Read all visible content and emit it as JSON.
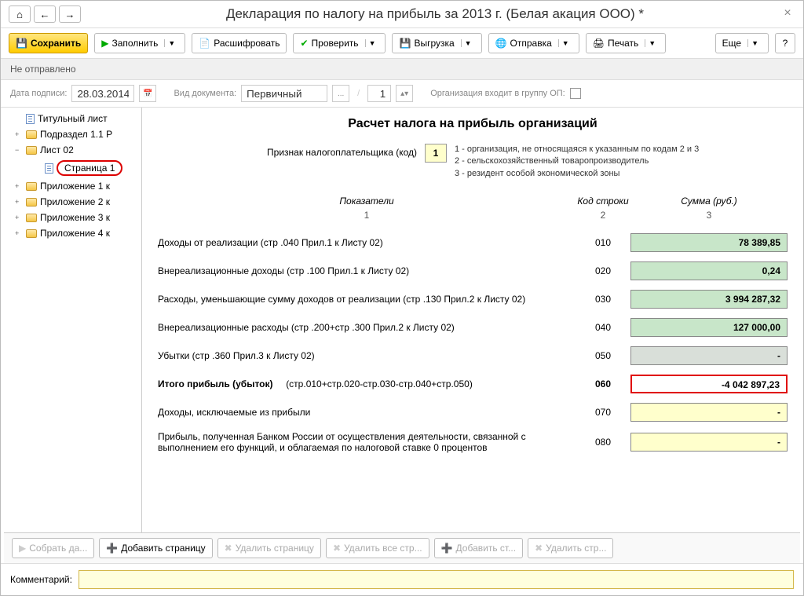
{
  "title": "Декларация по налогу на прибыль за 2013 г. (Белая акация ООО) *",
  "toolbar": {
    "save": "Сохранить",
    "fill": "Заполнить",
    "decode": "Расшифровать",
    "check": "Проверить",
    "export": "Выгрузка",
    "send": "Отправка",
    "print": "Печать",
    "more": "Еще"
  },
  "status": "Не отправлено",
  "params": {
    "date_label": "Дата подписи:",
    "date_value": "28.03.2014",
    "doc_type_label": "Вид документа:",
    "doc_type_value": "Первичный",
    "page_num": "1",
    "org_group_label": "Организация входит в группу ОП:"
  },
  "sidebar": {
    "items": [
      {
        "label": "Титульный лист",
        "type": "page",
        "indent": 1
      },
      {
        "label": "Подраздел 1.1 Р",
        "type": "folder",
        "indent": 1,
        "toggle": "+"
      },
      {
        "label": "Лист 02",
        "type": "folder",
        "indent": 1,
        "toggle": "−",
        "open": true
      },
      {
        "label": "Страница 1",
        "type": "page",
        "indent": 2,
        "selected": true
      },
      {
        "label": "Приложение 1 к",
        "type": "folder",
        "indent": 1,
        "toggle": "+"
      },
      {
        "label": "Приложение 2 к",
        "type": "folder",
        "indent": 1,
        "toggle": "+"
      },
      {
        "label": "Приложение 3 к",
        "type": "folder",
        "indent": 1,
        "toggle": "+"
      },
      {
        "label": "Приложение 4 к",
        "type": "folder",
        "indent": 1,
        "toggle": "+"
      }
    ]
  },
  "doc": {
    "heading": "Расчет налога на прибыль организаций",
    "taxpayer_label": "Признак налогоплательщика (код)",
    "taxpayer_code": "1",
    "taxpayer_notes": {
      "n1": "1 - организация, не относящаяся к указанным по кодам 2 и 3",
      "n2": "2 - сельскохозяйственный товаропроизводитель",
      "n3": "3 - резидент особой экономической зоны"
    },
    "headers": {
      "indicator": "Показатели",
      "code": "Код строки",
      "sum": "Сумма (руб.)",
      "c1": "1",
      "c2": "2",
      "c3": "3"
    },
    "rows": [
      {
        "label": "Доходы от реализации (стр .040 Прил.1 к Листу 02)",
        "code": "010",
        "value": "78 389,85",
        "style": "green"
      },
      {
        "label": "Внереализационные доходы (стр .100 Прил.1 к Листу 02)",
        "code": "020",
        "value": "0,24",
        "style": "green"
      },
      {
        "label": "Расходы, уменьшающие сумму доходов от реализации (стр .130 Прил.2 к Листу 02)",
        "code": "030",
        "value": "3 994 287,32",
        "style": "green"
      },
      {
        "label": "Внереализационные расходы (стр .200+стр .300 Прил.2 к Листу 02)",
        "code": "040",
        "value": "127 000,00",
        "style": "green"
      },
      {
        "label": "Убытки (стр .360 Прил.3 к Листу 02)",
        "code": "050",
        "value": "-",
        "style": "gray"
      },
      {
        "label": "Итого прибыль (убыток)",
        "label2": "(стр.010+стр.020-стр.030-стр.040+стр.050)",
        "code": "060",
        "value": "-4 042 897,23",
        "style": "red",
        "bold": true
      },
      {
        "label": "Доходы, исключаемые из прибыли",
        "code": "070",
        "value": "-",
        "style": "yellow"
      },
      {
        "label": "Прибыль, полученная Банком России от осуществления деятельности, связанной с выполнением его функций, и облагаемая по налоговой ставке 0 процентов",
        "code": "080",
        "value": "-",
        "style": "yellow"
      }
    ]
  },
  "bottom_toolbar": {
    "collect": "Собрать да...",
    "add_page": "Добавить страницу",
    "del_page": "Удалить страницу",
    "del_all": "Удалить все стр...",
    "add_str": "Добавить ст...",
    "del_str": "Удалить стр..."
  },
  "comment_label": "Комментарий:"
}
